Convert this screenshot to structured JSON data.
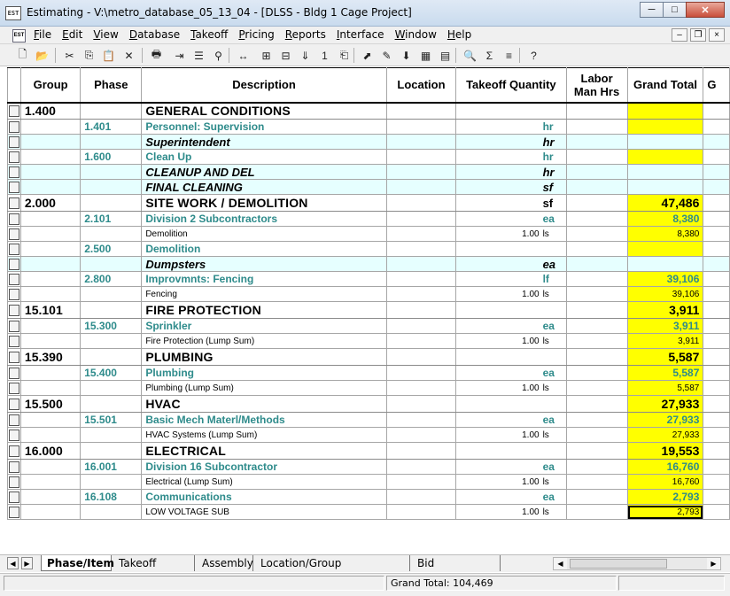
{
  "window": {
    "icon_text": "EST",
    "title": "Estimating - V:\\metro_database_05_13_04 - [DLSS - Bldg 1 Cage Project]",
    "minimize": "─",
    "maximize": "□",
    "close": "✕"
  },
  "menubar": {
    "doc_icon_text": "EST",
    "items": [
      "File",
      "Edit",
      "View",
      "Database",
      "Takeoff",
      "Pricing",
      "Reports",
      "Interface",
      "Window",
      "Help"
    ],
    "mdi_minimize": "–",
    "mdi_restore": "❐",
    "mdi_close": "×"
  },
  "toolbar": {
    "icons": [
      "new-icon",
      "open-icon",
      "cut-icon",
      "copy-icon",
      "paste-icon",
      "delete-icon",
      "print-icon",
      "insert-row-icon",
      "outline-icon",
      "find-binoculars-icon",
      "fit-width-icon",
      "expand-icon",
      "collapse-icon",
      "level-icon",
      "level-one-icon",
      "copy-format-icon",
      "takeoff-icon",
      "edit-icon",
      "move-down-icon",
      "spreadsheet-icon",
      "calculator-icon",
      "search-icon",
      "sum-icon",
      "item-list-icon",
      "help-icon"
    ],
    "glyphs": [
      "🗋",
      "📂",
      "✂",
      "⎘",
      "📋",
      "✕",
      "🖶",
      "⇥",
      "☰",
      "⚲",
      "↔",
      "⊞",
      "⊟",
      "⇓",
      "1",
      "⎗",
      "⬈",
      "✎",
      "⬇",
      "▦",
      "▤",
      "🔍",
      "Σ",
      "≡",
      "?"
    ]
  },
  "grid": {
    "headers": {
      "group": "Group",
      "phase": "Phase",
      "description": "Description",
      "location": "Location",
      "takeoff_qty": "Takeoff Quantity",
      "labor_hrs": "Labor Man Hrs",
      "grand_total": "Grand Total",
      "extra": "G"
    },
    "rows": [
      {
        "type": "group",
        "group": "1.400",
        "phase": "",
        "desc": "GENERAL CONDITIONS",
        "qty": "",
        "unit": "",
        "total": "",
        "yellow": true
      },
      {
        "type": "phase",
        "group": "",
        "phase": "1.401",
        "desc": "Personnel: Supervision",
        "qty": "",
        "unit": "hr",
        "total": "",
        "yellow": true
      },
      {
        "type": "italic",
        "group": "",
        "phase": "",
        "desc": "Superintendent",
        "qty": "",
        "unit": "hr",
        "total": "",
        "yellow": false
      },
      {
        "type": "phase",
        "group": "",
        "phase": "1.600",
        "desc": "Clean Up",
        "qty": "",
        "unit": "hr",
        "total": "",
        "yellow": true
      },
      {
        "type": "italic",
        "group": "",
        "phase": "",
        "desc": "CLEANUP AND DEL",
        "qty": "",
        "unit": "hr",
        "total": "",
        "yellow": false
      },
      {
        "type": "italic",
        "group": "",
        "phase": "",
        "desc": "FINAL CLEANING",
        "qty": "",
        "unit": "sf",
        "total": "",
        "yellow": false
      },
      {
        "type": "group",
        "group": "2.000",
        "phase": "",
        "desc": "SITE WORK / DEMOLITION",
        "qty": "",
        "unit": "sf",
        "total": "47,486",
        "yellow": true
      },
      {
        "type": "phase",
        "group": "",
        "phase": "2.101",
        "desc": "Division 2 Subcontractors",
        "qty": "",
        "unit": "ea",
        "total": "8,380",
        "yellow": true
      },
      {
        "type": "item",
        "group": "",
        "phase": "",
        "desc": "Demolition",
        "qty": "1.00",
        "unit": "ls",
        "total": "8,380",
        "yellow": true
      },
      {
        "type": "phase",
        "group": "",
        "phase": "2.500",
        "desc": "Demolition",
        "qty": "",
        "unit": "",
        "total": "",
        "yellow": true
      },
      {
        "type": "italic",
        "group": "",
        "phase": "",
        "desc": "Dumpsters",
        "qty": "",
        "unit": "ea",
        "total": "",
        "yellow": false
      },
      {
        "type": "phase",
        "group": "",
        "phase": "2.800",
        "desc": "Improvmnts: Fencing",
        "qty": "",
        "unit": "lf",
        "total": "39,106",
        "yellow": true
      },
      {
        "type": "item",
        "group": "",
        "phase": "",
        "desc": "Fencing",
        "qty": "1.00",
        "unit": "ls",
        "total": "39,106",
        "yellow": true
      },
      {
        "type": "group",
        "group": "15.101",
        "phase": "",
        "desc": "FIRE PROTECTION",
        "qty": "",
        "unit": "",
        "total": "3,911",
        "yellow": true
      },
      {
        "type": "phase",
        "group": "",
        "phase": "15.300",
        "desc": "Sprinkler",
        "qty": "",
        "unit": "ea",
        "total": "3,911",
        "yellow": true
      },
      {
        "type": "item",
        "group": "",
        "phase": "",
        "desc": "Fire Protection (Lump Sum)",
        "qty": "1.00",
        "unit": "ls",
        "total": "3,911",
        "yellow": true
      },
      {
        "type": "group",
        "group": "15.390",
        "phase": "",
        "desc": "PLUMBING",
        "qty": "",
        "unit": "",
        "total": "5,587",
        "yellow": true
      },
      {
        "type": "phase",
        "group": "",
        "phase": "15.400",
        "desc": "Plumbing",
        "qty": "",
        "unit": "ea",
        "total": "5,587",
        "yellow": true
      },
      {
        "type": "item",
        "group": "",
        "phase": "",
        "desc": "Plumbing (Lump Sum)",
        "qty": "1.00",
        "unit": "ls",
        "total": "5,587",
        "yellow": true
      },
      {
        "type": "group",
        "group": "15.500",
        "phase": "",
        "desc": "HVAC",
        "qty": "",
        "unit": "",
        "total": "27,933",
        "yellow": true
      },
      {
        "type": "phase",
        "group": "",
        "phase": "15.501",
        "desc": "Basic Mech Materl/Methods",
        "qty": "",
        "unit": "ea",
        "total": "27,933",
        "yellow": true
      },
      {
        "type": "item",
        "group": "",
        "phase": "",
        "desc": "HVAC Systems (Lump Sum)",
        "qty": "1.00",
        "unit": "ls",
        "total": "27,933",
        "yellow": true
      },
      {
        "type": "group",
        "group": "16.000",
        "phase": "",
        "desc": "ELECTRICAL",
        "qty": "",
        "unit": "",
        "total": "19,553",
        "yellow": true
      },
      {
        "type": "phase",
        "group": "",
        "phase": "16.001",
        "desc": "Division 16 Subcontractor",
        "qty": "",
        "unit": "ea",
        "total": "16,760",
        "yellow": true
      },
      {
        "type": "item",
        "group": "",
        "phase": "",
        "desc": "Electrical (Lump Sum)",
        "qty": "1.00",
        "unit": "ls",
        "total": "16,760",
        "yellow": true
      },
      {
        "type": "phase",
        "group": "",
        "phase": "16.108",
        "desc": "Communications",
        "qty": "",
        "unit": "ea",
        "total": "2,793",
        "yellow": true
      },
      {
        "type": "item",
        "group": "",
        "phase": "",
        "desc": "LOW VOLTAGE SUB",
        "qty": "1.00",
        "unit": "ls",
        "total": "2,793",
        "yellow": true
      }
    ]
  },
  "tabs": {
    "nav_first": "|◀",
    "nav_prev": "◀",
    "nav_next": "▶",
    "nav_last": "▶|",
    "items": [
      "Phase/Item",
      "Takeoff Order",
      "Assembly",
      "Location/Group phase/Phase",
      "Bid Item/Phase"
    ]
  },
  "scroll": {
    "left": "◀",
    "right": "▶"
  },
  "status": {
    "grand_total": "Grand Total: 104,469"
  },
  "colors": {
    "yellow": "#ffff00",
    "teal": "#2e8b8b",
    "cyan_row": "#e6ffff"
  }
}
